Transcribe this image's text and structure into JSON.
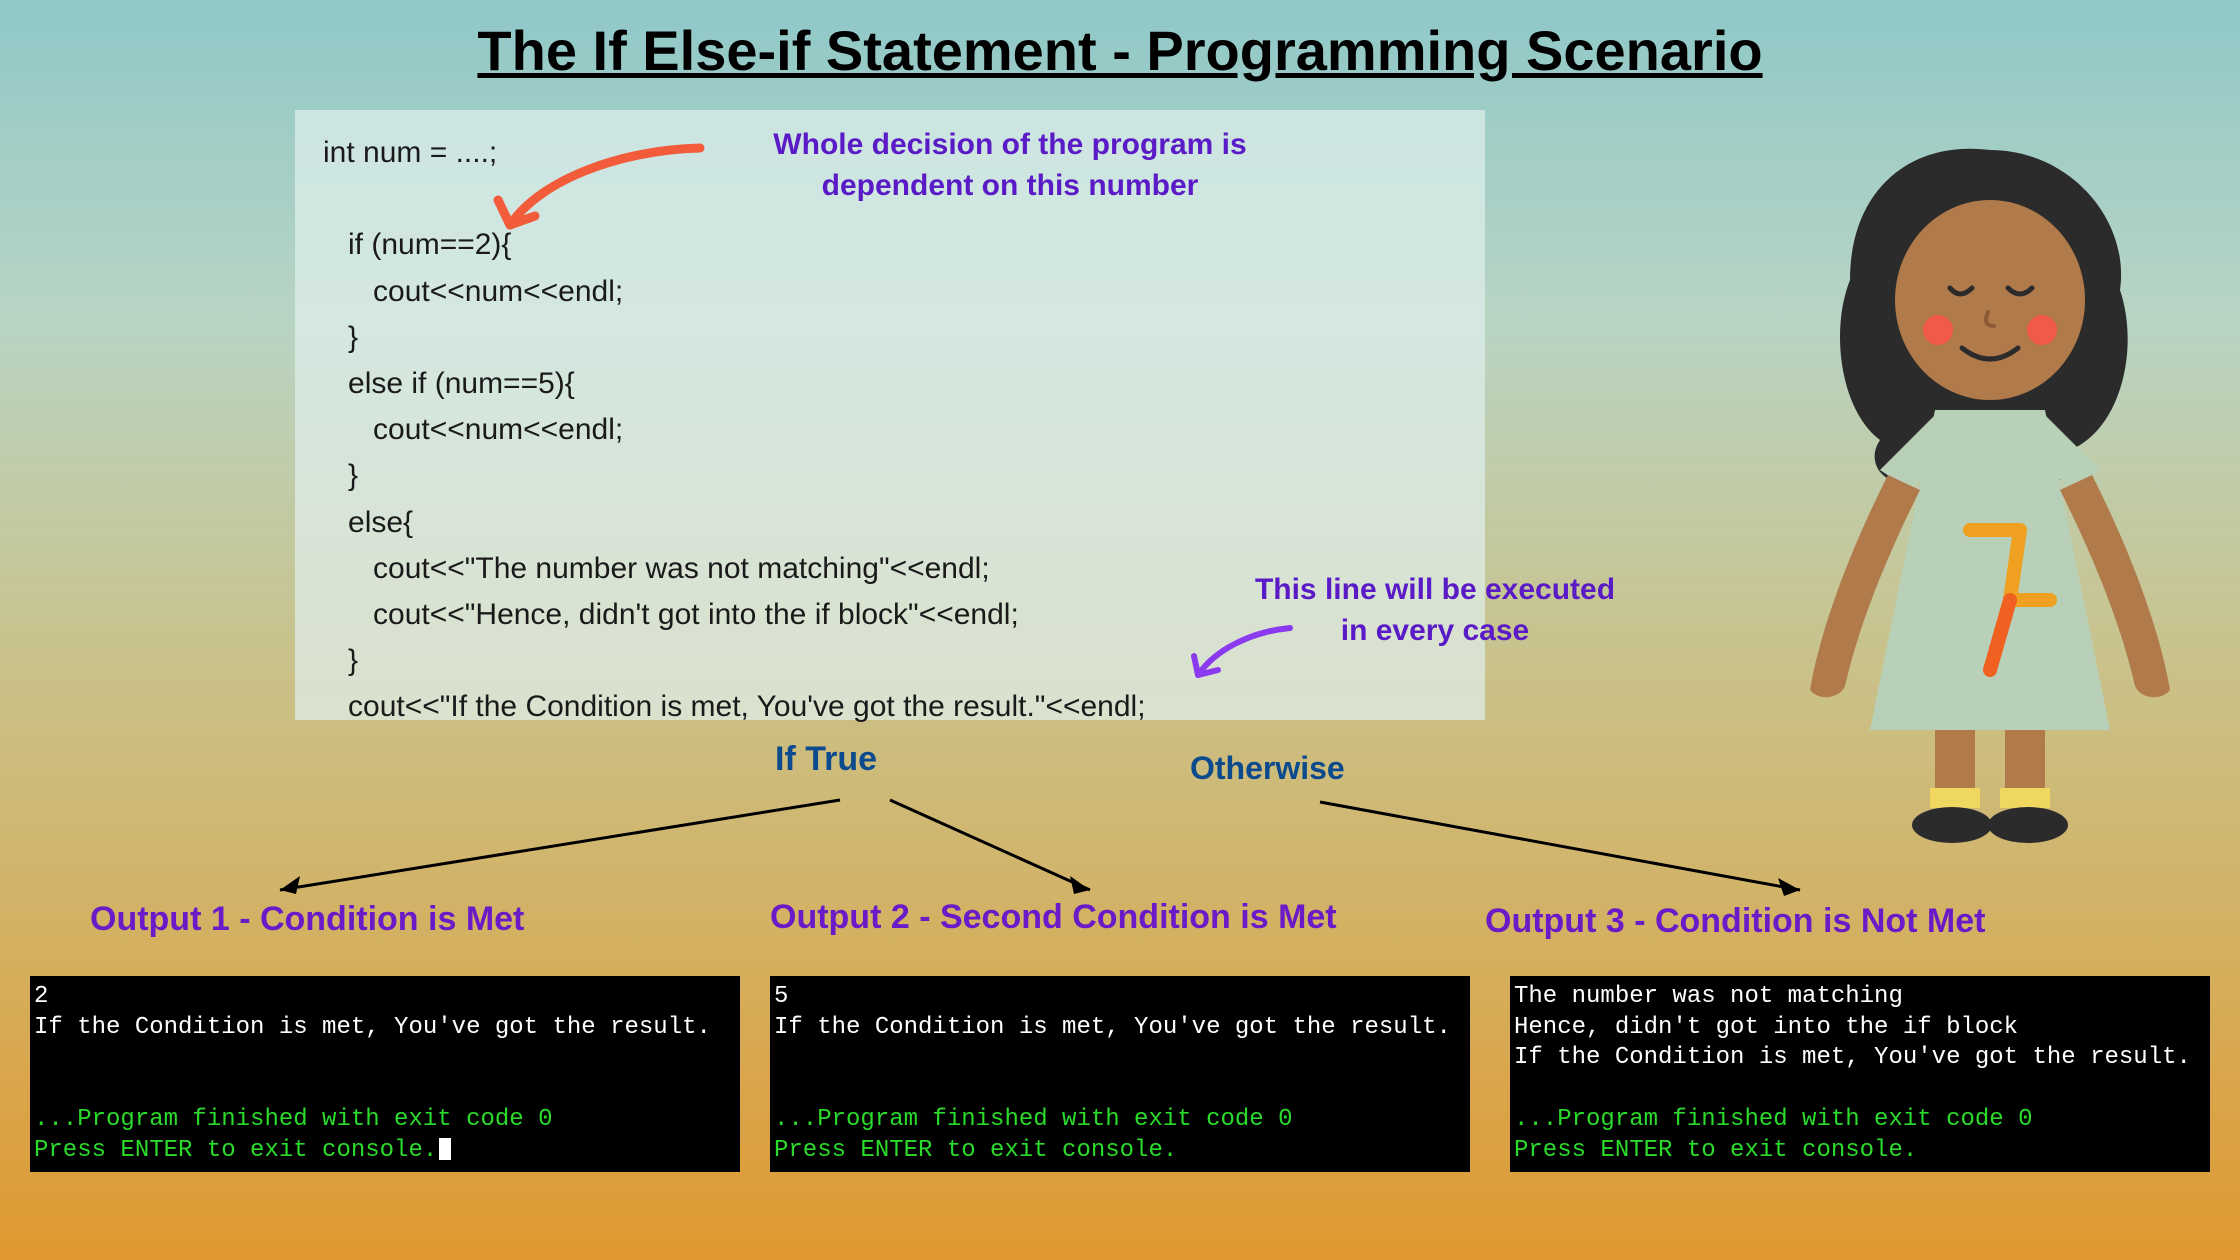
{
  "title": "The If Else-if Statement - Programming Scenario",
  "code": {
    "l1": "int num = ....;",
    "l2": "   if (num==2){",
    "l3": "      cout<<num<<endl;",
    "l4": "   }",
    "l5": "   else if (num==5){",
    "l6": "      cout<<num<<endl;",
    "l7": "   }",
    "l8": "   else{",
    "l9": "      cout<<\"The number was not matching\"<<endl;",
    "l10": "      cout<<\"Hence, didn't got into the if block\"<<endl;",
    "l11": "   }",
    "l12": "   cout<<\"If the Condition is met, You've got the result.\"<<endl;"
  },
  "annotations": {
    "decision": "Whole decision of the program is dependent on this number",
    "every_case": "This line will be executed in every case"
  },
  "branches": {
    "if_true": "If True",
    "otherwise": "Otherwise"
  },
  "outputs": {
    "label1": "Output 1 - Condition is Met",
    "label2": "Output 2 - Second Condition is Met",
    "label3": "Output 3 - Condition is Not Met",
    "console1": {
      "l1": "2",
      "l2": "If the Condition is met, You've got the result.",
      "l3": "",
      "l4": "",
      "l5": "...Program finished with exit code 0",
      "l6": "Press ENTER to exit console."
    },
    "console2": {
      "l1": "5",
      "l2": "If the Condition is met, You've got the result.",
      "l3": "",
      "l4": "",
      "l5": "...Program finished with exit code 0",
      "l6": "Press ENTER to exit console."
    },
    "console3": {
      "l1": "The number was not matching",
      "l2": "Hence, didn't got into the if block",
      "l3": "If the Condition is met, You've got the result.",
      "l4": "",
      "l5": "...Program finished with exit code 0",
      "l6": "Press ENTER to exit console."
    }
  }
}
